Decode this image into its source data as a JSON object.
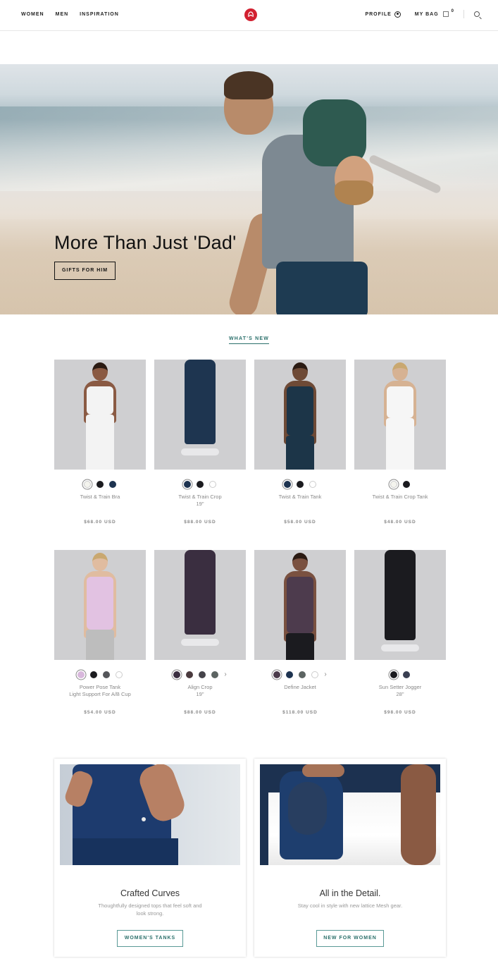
{
  "header": {
    "nav": [
      "WOMEN",
      "MEN",
      "INSPIRATION"
    ],
    "profile_label": "PROFILE",
    "bag_label": "MY BAG",
    "bag_count": "0",
    "icons": [
      "lululemon-logo-icon",
      "profile-icon",
      "bag-icon",
      "search-icon"
    ]
  },
  "hero": {
    "title": "More Than Just 'Dad'",
    "button": "GIFTS FOR HIM"
  },
  "section": {
    "heading": "WHAT'S NEW"
  },
  "products": [
    {
      "name": "Twist & Train Bra",
      "name2": "",
      "price": "$68.00 USD",
      "swatches": [
        "#f4f4ee",
        "#1b1b1f",
        "#1d3350"
      ],
      "selected": 0,
      "more": false
    },
    {
      "name": "Twist & Train Crop",
      "name2": "19\"",
      "price": "$88.00 USD",
      "swatches": [
        "#1d3350",
        "#1b1b1f",
        "#ffffff"
      ],
      "selected": 0,
      "more": false
    },
    {
      "name": "Twist & Train Tank",
      "name2": "",
      "price": "$58.00 USD",
      "swatches": [
        "#1d3350",
        "#1b1b1f",
        "#ffffff"
      ],
      "selected": 0,
      "more": false
    },
    {
      "name": "Twist & Train Crop Tank",
      "name2": "",
      "price": "$48.00 USD",
      "swatches": [
        "#f4f4ee",
        "#1b1b1f"
      ],
      "selected": 0,
      "more": false
    },
    {
      "name": "Power Pose Tank",
      "name2": "Light Support For A/B Cup",
      "price": "$54.00 USD",
      "swatches": [
        "#d8b8dc",
        "#1b1b1f",
        "#55565a",
        "#ffffff"
      ],
      "selected": 0,
      "more": false
    },
    {
      "name": "Align Crop",
      "name2": "19\"",
      "price": "$88.00 USD",
      "swatches": [
        "#3a2e40",
        "#4a3a3e",
        "#45434a",
        "#5c6462"
      ],
      "selected": 0,
      "more": true
    },
    {
      "name": "Define Jacket",
      "name2": "",
      "price": "$118.00 USD",
      "swatches": [
        "#4a3a4a",
        "#1d3350",
        "#5c6462",
        "#ffffff"
      ],
      "selected": 0,
      "more": true
    },
    {
      "name": "Sun Setter Jogger",
      "name2": "28\"",
      "price": "$98.00 USD",
      "swatches": [
        "#1b1b1f",
        "#3a3f52"
      ],
      "selected": 0,
      "more": false
    }
  ],
  "features": [
    {
      "title": "Crafted Curves",
      "desc": "Thoughtfully designed tops that feel soft and look strong.",
      "button": "WOMEN'S TANKS"
    },
    {
      "title": "All in the Detail.",
      "desc": "Stay cool in style with new lattice Mesh gear.",
      "button": "NEW FOR WOMEN"
    }
  ],
  "colors": {
    "accent": "#2a6f6a",
    "logo": "#d22030"
  }
}
